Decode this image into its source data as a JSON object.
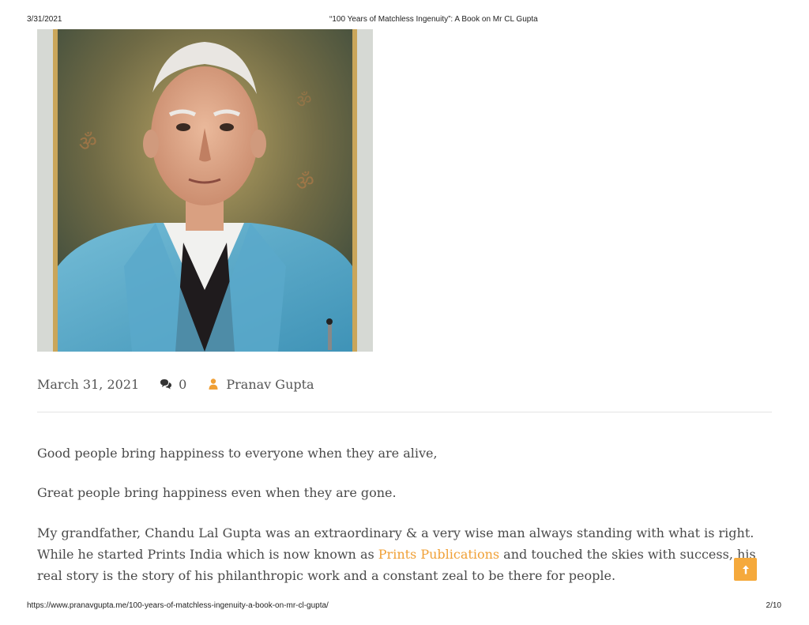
{
  "print_header": {
    "date": "3/31/2021",
    "title": "“100 Years of Matchless Ingenuity”: A Book on Mr CL Gupta"
  },
  "post_meta": {
    "date": "March 31, 2021",
    "comment_count": "0",
    "author": "Pranav Gupta",
    "accent_color": "#f0a036"
  },
  "content": {
    "paragraph_1": "Good people bring happiness to everyone when they are alive,",
    "paragraph_2": "Great people bring happiness even when they are gone.",
    "paragraph_3_before_link": "My grandfather, Chandu Lal Gupta was an extraordinary & a very wise man always standing with what is right. While he started Prints India which is now known as ",
    "paragraph_3_link": "Prints Publications",
    "paragraph_3_after_link": " and touched the skies with success, his real story is the story of his philanthropic work and a constant zeal to be there for people."
  },
  "print_footer": {
    "url": "https://www.pranavgupta.me/100-years-of-matchless-ingenuity-a-book-on-mr-cl-gupta/",
    "page": "2/10"
  },
  "icons": {
    "comments": "comments-icon",
    "author": "user-icon",
    "scroll_top": "arrow-up-icon"
  }
}
